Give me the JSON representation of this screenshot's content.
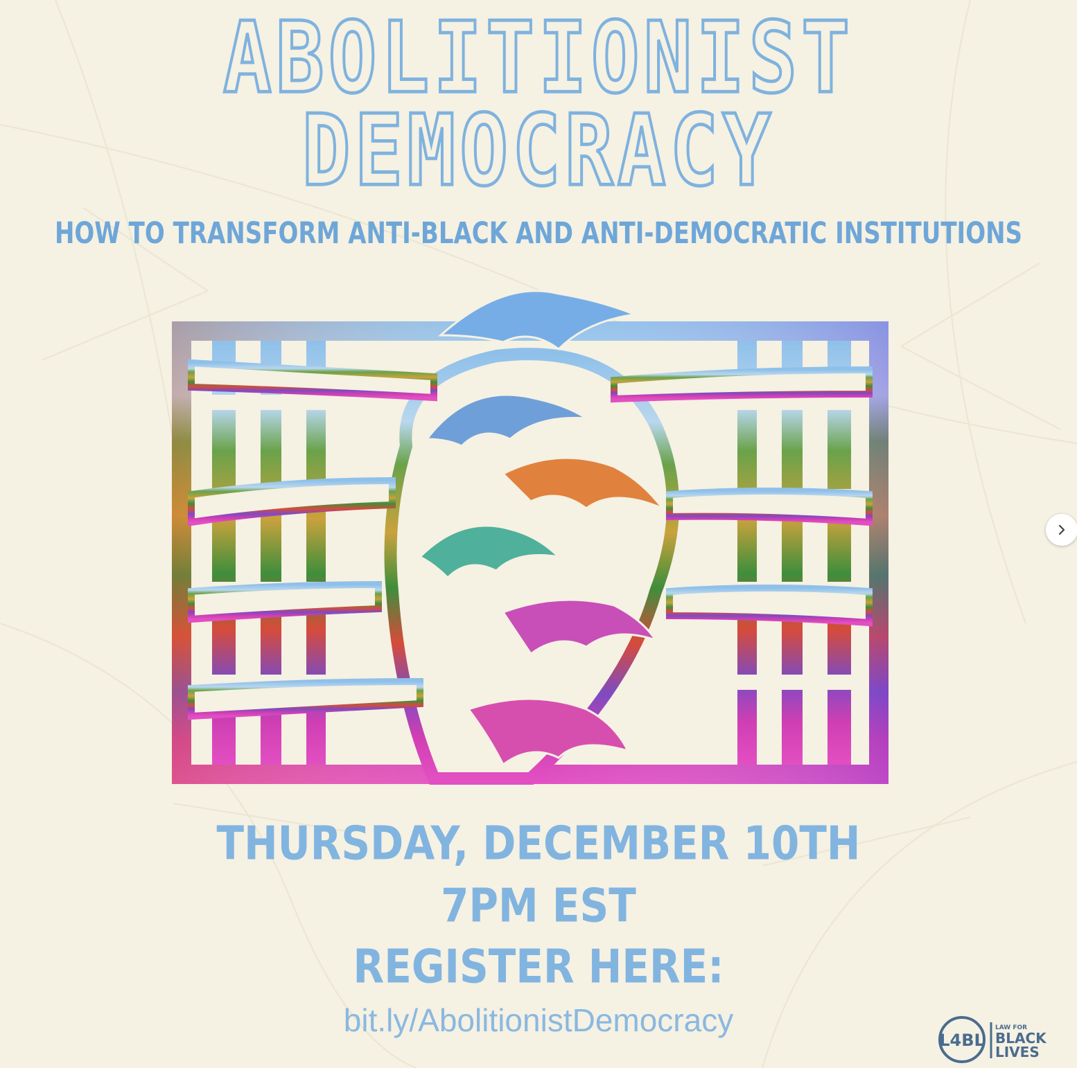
{
  "poster": {
    "title_line1": "ABOLITIONIST",
    "title_line2": "DEMOCRACY",
    "subtitle": "HOW TO TRANSFORM ANTI-BLACK AND ANTI-DEMOCRATIC INSTITUTIONS",
    "date": "THURSDAY, DECEMBER 10TH",
    "time": "7PM EST",
    "register": "REGISTER HERE:",
    "link": "bit.ly/AbolitionistDemocracy"
  },
  "logo": {
    "monogram": "L4BL",
    "line1": "LAW FOR",
    "line2": "BLACK LIVES"
  },
  "carousel": {
    "next_icon": "chevron-right-icon"
  },
  "colors": {
    "background": "#f5f1e3",
    "title_outline": "#7fb2de",
    "text_blue": "#82b4e0"
  }
}
